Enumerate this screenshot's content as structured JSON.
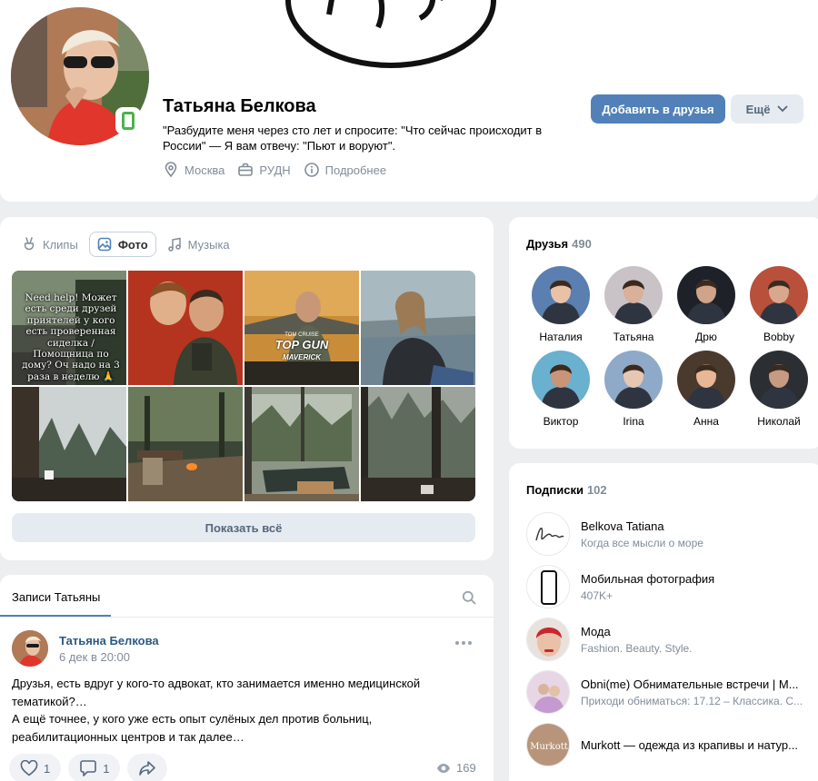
{
  "profile": {
    "name": "Татьяна Белкова",
    "status": "\"Разбудите меня через сто лет и спросите: \"Что сейчас происходит в России\" — Я вам отвечу: \"Пьют и воруют\".",
    "city": "Москва",
    "university": "РУДН",
    "more_label": "Подробнее",
    "add_friend_label": "Добавить в друзья",
    "more_button_label": "Ещё"
  },
  "media_tabs": [
    {
      "label": "Клипы",
      "icon": "clips-icon"
    },
    {
      "label": "Фото",
      "icon": "photo-icon",
      "active": true
    },
    {
      "label": "Музыка",
      "icon": "music-icon"
    }
  ],
  "photos": {
    "first_photo_text": "Need help! Может есть среди друзей приятелей у кого есть проверенная сиделка / Помощница по дому? Оч надо на 3 раза в неделю 🙏",
    "poster_small": "TOM CRUISE",
    "poster_title": "TOP GUN",
    "poster_subtitle": "MAVERICK",
    "show_all_label": "Показать всё"
  },
  "wall": {
    "tab_label": "Записи Татьяны",
    "post": {
      "author": "Татьяна Белкова",
      "date": "6 дек в 20:00",
      "text": "Друзья, есть вдруг у кого-то адвокат, кто занимается именно медицинской тематикой?…\nА ещё точнее, у кого уже есть опыт сулёных дел против больниц, реабилитационных центров и так далее…",
      "likes": "1",
      "comments": "1",
      "views": "169"
    }
  },
  "friends": {
    "title": "Друзья",
    "count": "490",
    "items": [
      {
        "name": "Наталия",
        "bg": "#5a7fb0",
        "skin": "#e9c2a6"
      },
      {
        "name": "Татьяна",
        "bg": "#c9c3c8",
        "skin": "#d9b099"
      },
      {
        "name": "Дрю",
        "bg": "#1e2228",
        "skin": "#cfa48a"
      },
      {
        "name": "Bobby",
        "bg": "#b8503c",
        "skin": "#d7a88e"
      },
      {
        "name": "Виктор",
        "bg": "#6ab0cf",
        "skin": "#c99478"
      },
      {
        "name": "Irina",
        "bg": "#8fa9c8",
        "skin": "#e6c7b4"
      },
      {
        "name": "Анна",
        "bg": "#4a3a2e",
        "skin": "#e8b795"
      },
      {
        "name": "Николай",
        "bg": "#2b2e33",
        "skin": "#c59b82"
      }
    ]
  },
  "subscriptions": {
    "title": "Подписки",
    "count": "102",
    "items": [
      {
        "name": "Belkova Tatiana",
        "desc": "Когда все мысли о море",
        "logo": "signature"
      },
      {
        "name": "Мобильная фотография",
        "desc": "407K+",
        "logo": "phone"
      },
      {
        "name": "Мода",
        "desc": "Fashion. Beauty. Style.",
        "logo": "face"
      },
      {
        "name": "Obni(me) Обнимательные встречи | М...",
        "desc": "Приходи обниматься: 17.12 – Классика. С...",
        "logo": "people"
      },
      {
        "name": "Murkott — одежда из крапивы и натур...",
        "desc": "",
        "logo": "Murkott"
      }
    ]
  },
  "colors": {
    "accent": "#5181b8",
    "link": "#2a5885",
    "online": "#4bb34b",
    "muted": "#818c99"
  }
}
